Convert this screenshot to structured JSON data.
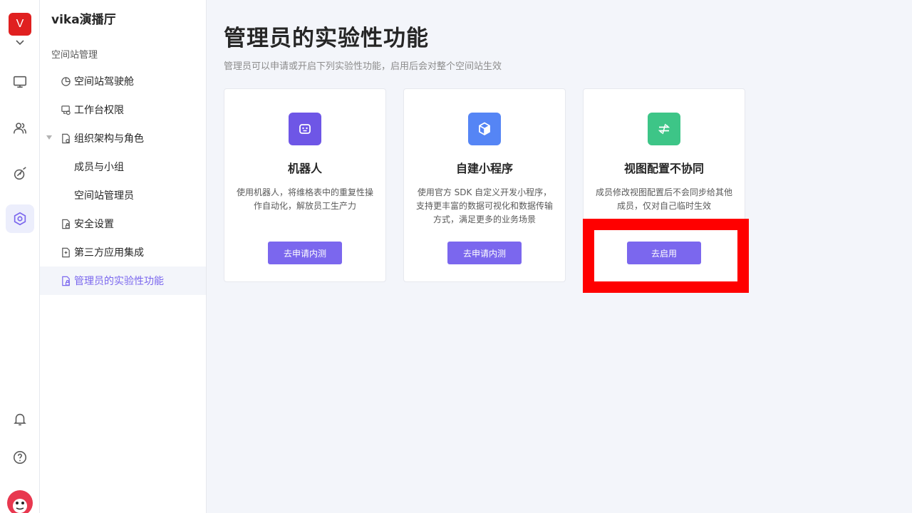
{
  "rail": {
    "space_initial": "V",
    "accent": "#7b67ee",
    "icons": [
      "workbench-icon",
      "contacts-icon",
      "explore-icon",
      "space-management-icon",
      "notification-bell-icon",
      "help-icon"
    ]
  },
  "sidebar": {
    "space_name": "vika演播厅",
    "section_title": "空间站管理",
    "items": [
      {
        "label": "空间站驾驶舱",
        "icon": "dashboard-pie-icon"
      },
      {
        "label": "工作台权限",
        "icon": "workbench-permission-icon"
      },
      {
        "label": "组织架构与角色",
        "icon": "org-structure-icon"
      },
      {
        "label": "成员与小组"
      },
      {
        "label": "空间站管理员"
      },
      {
        "label": "安全设置",
        "icon": "security-lock-icon"
      },
      {
        "label": "第三方应用集成",
        "icon": "integration-icon"
      },
      {
        "label": "管理员的实验性功能",
        "icon": "experimental-lab-icon"
      }
    ]
  },
  "main": {
    "title": "管理员的实验性功能",
    "description": "管理员可以申请或开启下列实验性功能，启用后会对整个空间站生效",
    "cards": [
      {
        "title": "机器人",
        "description": "使用机器人，将维格表中的重复性操作自动化，解放员工生产力",
        "button": "去申请内测",
        "icon": "robot-icon",
        "color": "#6e56e6"
      },
      {
        "title": "自建小程序",
        "description": "使用官方 SDK 自定义开发小程序，支持更丰富的数据可视化和数据传输方式，满足更多的业务场景",
        "button": "去申请内测",
        "icon": "widget-cube-icon",
        "color": "#5585f5"
      },
      {
        "title": "视图配置不协同",
        "description": "成员修改视图配置后不会同步给其他成员，仅对自己临时生效",
        "button": "去启用",
        "icon": "sync-off-icon",
        "color": "#3dc587"
      }
    ]
  }
}
